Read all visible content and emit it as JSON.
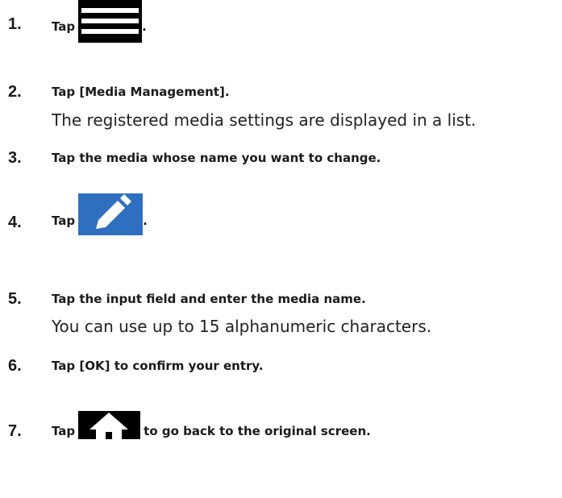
{
  "steps": [
    {
      "number": "1.",
      "text_before": "Tap",
      "icon": "menu-icon",
      "text_after": "."
    },
    {
      "number": "2.",
      "text": "Tap [Media Management].",
      "description": "The registered media settings are displayed in a list."
    },
    {
      "number": "3.",
      "text": "Tap the media whose name you want to change."
    },
    {
      "number": "4.",
      "text_before": "Tap",
      "icon": "edit-pencil-icon",
      "text_after": "."
    },
    {
      "number": "5.",
      "text": "Tap the input field and enter the media name.",
      "description": "You can use up to 15 alphanumeric characters."
    },
    {
      "number": "6.",
      "text": "Tap [OK] to confirm your entry."
    },
    {
      "number": "7.",
      "text_before": "Tap",
      "icon": "home-icon",
      "text_after": "to go back to the original screen."
    }
  ],
  "colors": {
    "text": "#1a1a1a",
    "edit_icon_bg": "#2f6fc0",
    "menu_icon_bg": "#000000",
    "home_icon_bg": "#000000"
  }
}
